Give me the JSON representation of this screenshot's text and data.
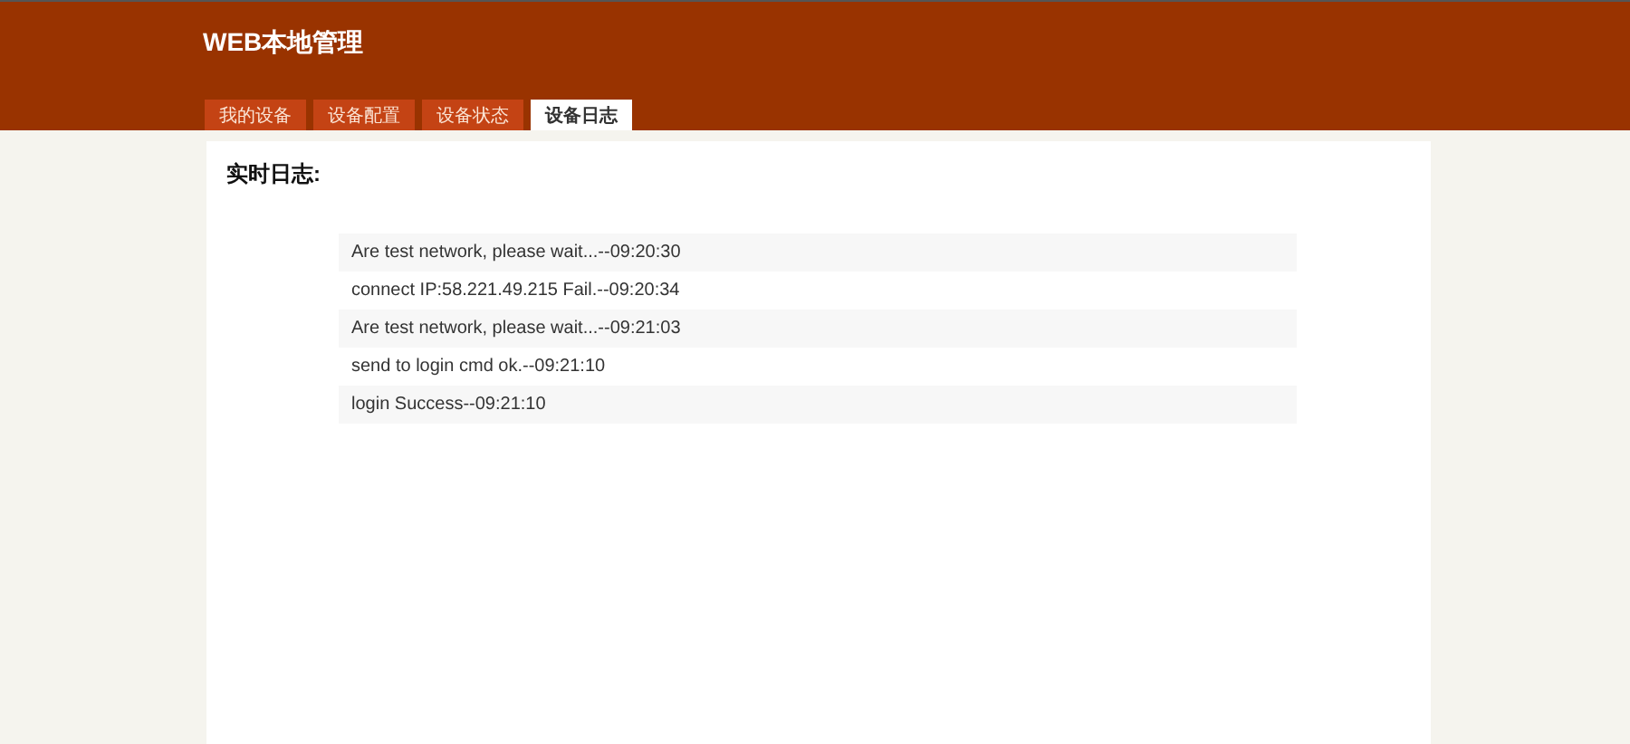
{
  "header": {
    "title": "WEB本地管理"
  },
  "tabs": [
    {
      "label": "我的设备",
      "selected": false
    },
    {
      "label": "设备配置",
      "selected": false
    },
    {
      "label": "设备状态",
      "selected": false
    },
    {
      "label": "设备日志",
      "selected": true
    }
  ],
  "section": {
    "title": "实时日志:"
  },
  "log": [
    "Are test network, please wait...--09:20:30",
    "connect IP:58.221.49.215 Fail.--09:20:34",
    "Are test network, please wait...--09:21:03",
    "send to login cmd ok.--09:21:10",
    "login Success--09:21:10"
  ]
}
